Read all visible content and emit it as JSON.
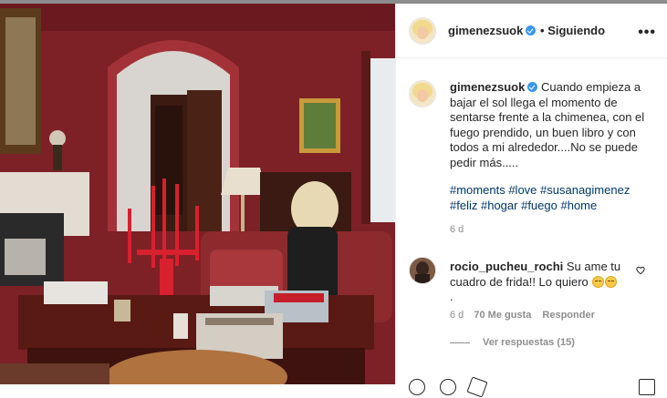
{
  "header": {
    "username": "gimenezsuok",
    "verified_icon": "verified-badge-icon",
    "follow_separator": "•",
    "follow_status": "Siguiendo",
    "more_icon": "more-options-icon"
  },
  "post": {
    "username": "gimenezsuok",
    "caption": "Cuando empieza a bajar el sol llega el momento de sentarse frente a la chimenea, con el fuego prendido, un buen libro y con todos a mi alrededor....No se puede pedir más.....",
    "hashtags": [
      "#moments",
      "#love",
      "#susanagimenez",
      "#feliz",
      "#hogar",
      "#fuego",
      "#home"
    ],
    "time": "6 d"
  },
  "comments": [
    {
      "username": "rocio_pucheu_rochi",
      "text": "Su ame tu cuadro de frida!! Lo quiero",
      "emoji_icons": [
        "smiling-face-icon",
        "smiling-face-icon"
      ],
      "trailing": ".",
      "time": "6 d",
      "likes": "70 Me gusta",
      "reply_label": "Responder",
      "view_replies": "Ver respuestas (15)"
    }
  ],
  "colors": {
    "link": "#00376b",
    "verified": "#3897f0",
    "meta": "#8e8e8e",
    "wall": "#7a1f24"
  }
}
